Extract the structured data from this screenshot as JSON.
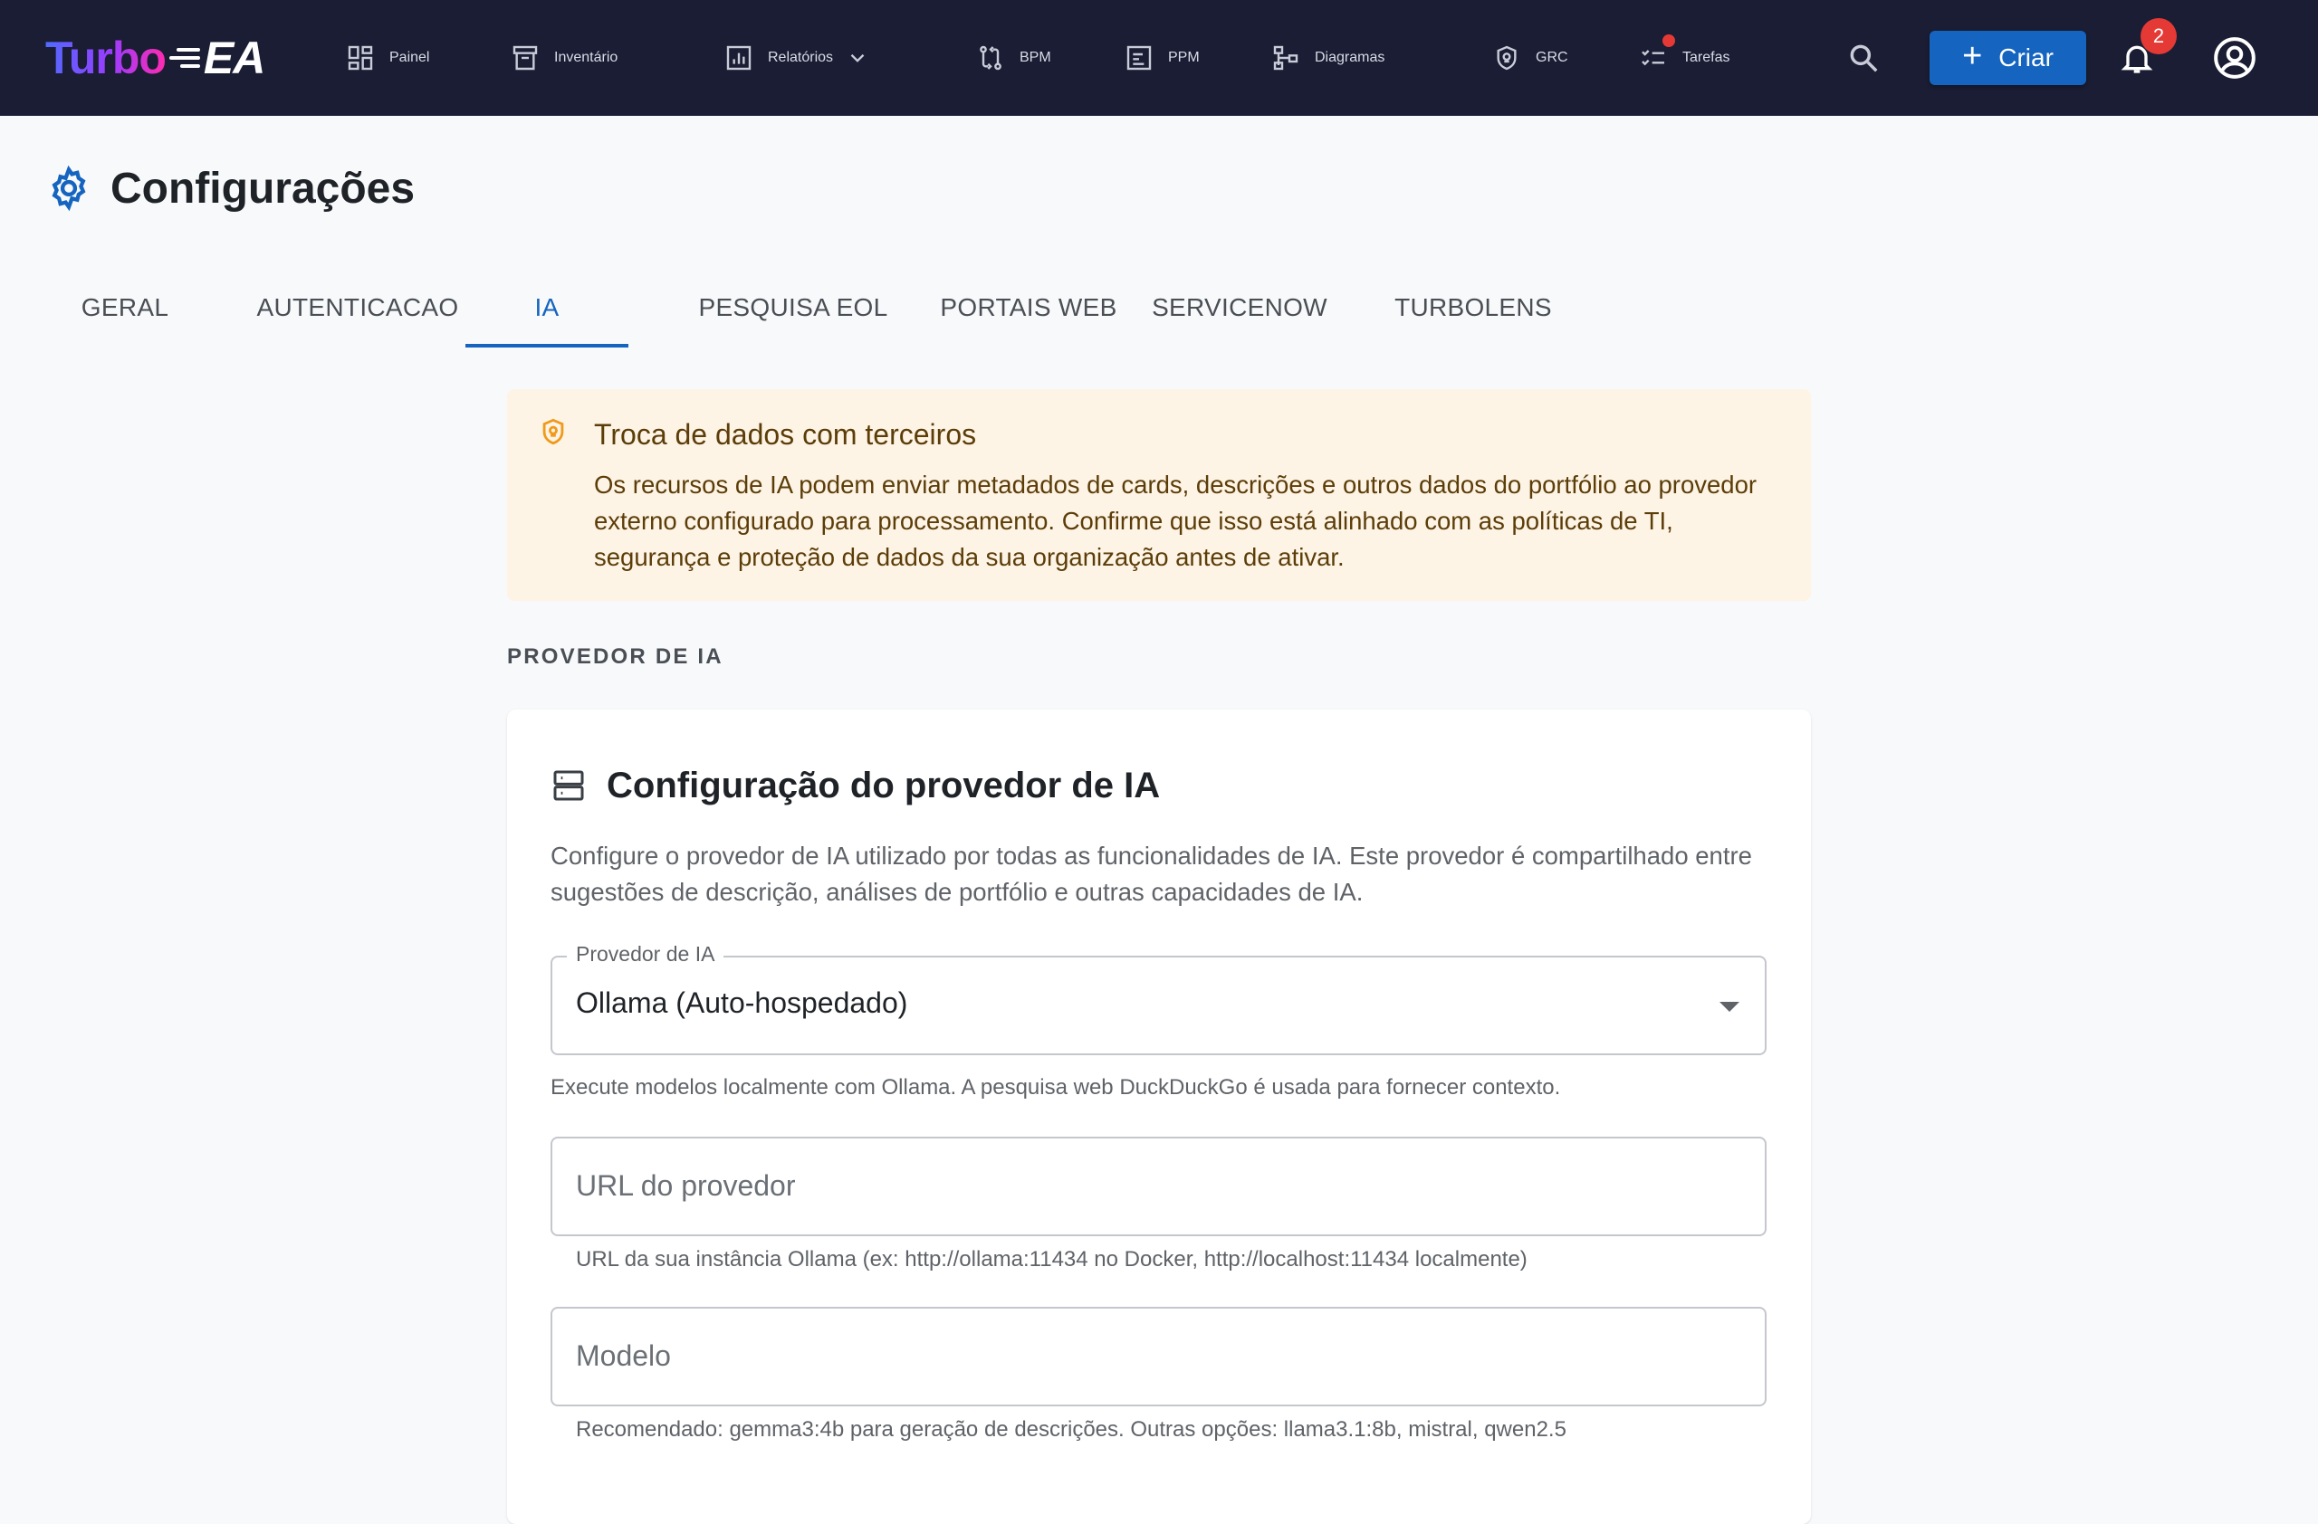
{
  "app": {
    "logo_turbo": "Turbo",
    "logo_ea": "EA"
  },
  "nav": {
    "items": [
      {
        "label": "Painel",
        "icon": "dashboard-icon"
      },
      {
        "label": "Inventário",
        "icon": "inventory-icon"
      },
      {
        "label": "Relatórios",
        "icon": "reports-icon"
      },
      {
        "label": "BPM",
        "icon": "bpm-icon"
      },
      {
        "label": "PPM",
        "icon": "ppm-icon"
      },
      {
        "label": "Diagramas",
        "icon": "diagrams-icon"
      },
      {
        "label": "GRC",
        "icon": "shield-icon"
      },
      {
        "label": "Tarefas",
        "icon": "tasks-icon"
      }
    ],
    "create_label": "Criar",
    "notification_count": "2"
  },
  "page": {
    "title": "Configurações",
    "tabs": [
      "GERAL",
      "AUTENTICACAO",
      "IA",
      "PESQUISA EOL",
      "PORTAIS WEB",
      "SERVICENOW",
      "TURBOLENS"
    ],
    "active_tab": "IA"
  },
  "alert": {
    "title": "Troca de dados com terceiros",
    "body": "Os recursos de IA podem enviar metadados de cards, descrições e outros dados do portfólio ao provedor externo configurado para processamento. Confirme que isso está alinhado com as políticas de TI, segurança e proteção de dados da sua organização antes de ativar."
  },
  "section": {
    "label": "PROVEDOR DE IA"
  },
  "card": {
    "title": "Configuração do provedor de IA",
    "description": "Configure o provedor de IA utilizado por todas as funcionalidades de IA. Este provedor é compartilhado entre sugestões de descrição, análises de portfólio e outras capacidades de IA.",
    "provider": {
      "label": "Provedor de IA",
      "value": "Ollama (Auto-hospedado)",
      "helper": "Execute modelos localmente com Ollama. A pesquisa web DuckDuckGo é usada para fornecer contexto."
    },
    "url": {
      "placeholder": "URL do provedor",
      "helper": "URL da sua instância Ollama (ex: http://ollama:11434 no Docker, http://localhost:11434 localmente)"
    },
    "model": {
      "placeholder": "Modelo",
      "helper": "Recomendado: gemma3:4b para geração de descrições. Outras opções: llama3.1:8b, mistral, qwen2.5"
    }
  },
  "colors": {
    "topbar": "#1a1d33",
    "accent": "#1565c0",
    "alert_bg": "#fdf4e6",
    "alert_text": "#5c3d08",
    "badge": "#e53935"
  }
}
